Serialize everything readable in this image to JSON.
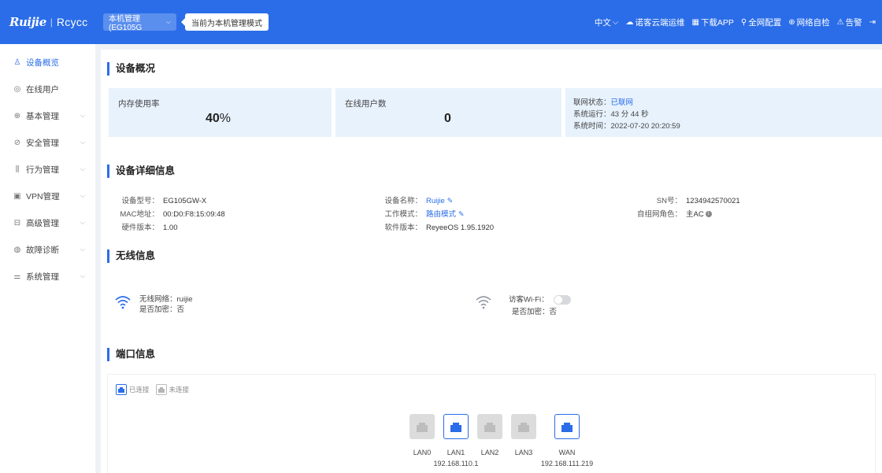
{
  "header": {
    "logo_brand": "Ruijie",
    "logo_sub": "Rcycc",
    "mode_select": "本机管理(EG105G",
    "mode_tip": "当前为本机管理模式",
    "right_items": [
      {
        "label": "中文",
        "icon": "chevron-down-icon"
      },
      {
        "label": "诺客云端运维",
        "icon": "cloud-icon"
      },
      {
        "label": "下载APP",
        "icon": "qrcode-icon"
      },
      {
        "label": "全网配置",
        "icon": "network-icon"
      },
      {
        "label": "网络自检",
        "icon": "search-icon"
      },
      {
        "label": "告警",
        "icon": "alarm-icon"
      }
    ]
  },
  "sidebar": {
    "items": [
      {
        "label": "设备概览",
        "icon": "topology-icon",
        "active": true,
        "expandable": false
      },
      {
        "label": "在线用户",
        "icon": "user-icon",
        "active": false,
        "expandable": false
      },
      {
        "label": "基本管理",
        "icon": "globe-icon",
        "active": false,
        "expandable": true
      },
      {
        "label": "安全管理",
        "icon": "shield-icon",
        "active": false,
        "expandable": true
      },
      {
        "label": "行为管理",
        "icon": "bar-chart-icon",
        "active": false,
        "expandable": true
      },
      {
        "label": "VPN管理",
        "icon": "monitor-icon",
        "active": false,
        "expandable": true
      },
      {
        "label": "高级管理",
        "icon": "advanced-icon",
        "active": false,
        "expandable": true
      },
      {
        "label": "故障诊断",
        "icon": "diagnose-icon",
        "active": false,
        "expandable": true
      },
      {
        "label": "系统管理",
        "icon": "settings-icon",
        "active": false,
        "expandable": true
      }
    ]
  },
  "overview": {
    "title": "设备概况",
    "memory_label": "内存使用率",
    "memory_value": "40",
    "memory_unit": "%",
    "users_label": "在线用户数",
    "users_value": "0",
    "net_status_label": "联网状态：",
    "net_status_value": "已联网",
    "uptime_label": "系统运行：",
    "uptime_value": "43 分 44 秒",
    "systime_label": "系统时间：",
    "systime_value": "2022-07-20 20:20:59"
  },
  "details": {
    "title": "设备详细信息",
    "model_label": "设备型号：",
    "model_value": "EG105GW-X",
    "mac_label": "MAC地址：",
    "mac_value": "00:D0:F8:15:09:48",
    "hw_label": "硬件版本：",
    "hw_value": "1.00",
    "name_label": "设备名称：",
    "name_value": "Ruijie",
    "mode_label": "工作模式：",
    "mode_value": "路由模式",
    "sw_label": "软件版本：",
    "sw_value": "ReyeeOS 1.95.1920",
    "sn_label": "SN号：",
    "sn_value": "1234942570021",
    "role_label": "自组网角色：",
    "role_value": "主AC"
  },
  "wireless": {
    "title": "无线信息",
    "ssid_label": "无线网络：",
    "ssid_value": "ruijie",
    "enc_label": "是否加密：",
    "enc_value": "否",
    "guest_label": "访客Wi-Fi：",
    "guest_enc_label": "是否加密：",
    "guest_enc_value": "否"
  },
  "ports": {
    "title": "端口信息",
    "legend_connected": "已连接",
    "legend_disconnected": "未连接",
    "list": [
      {
        "name": "LAN0",
        "ip": "",
        "connected": false
      },
      {
        "name": "LAN1",
        "ip": "192.168.110.1",
        "connected": true
      },
      {
        "name": "LAN2",
        "ip": "",
        "connected": false
      },
      {
        "name": "LAN3",
        "ip": "",
        "connected": false
      },
      {
        "name": "WAN",
        "ip": "192.168.111.219",
        "connected": true
      }
    ]
  },
  "colors": {
    "primary": "#2b6de8",
    "card_bg": "#e8f2fd",
    "port_off": "#dcdcdc"
  }
}
